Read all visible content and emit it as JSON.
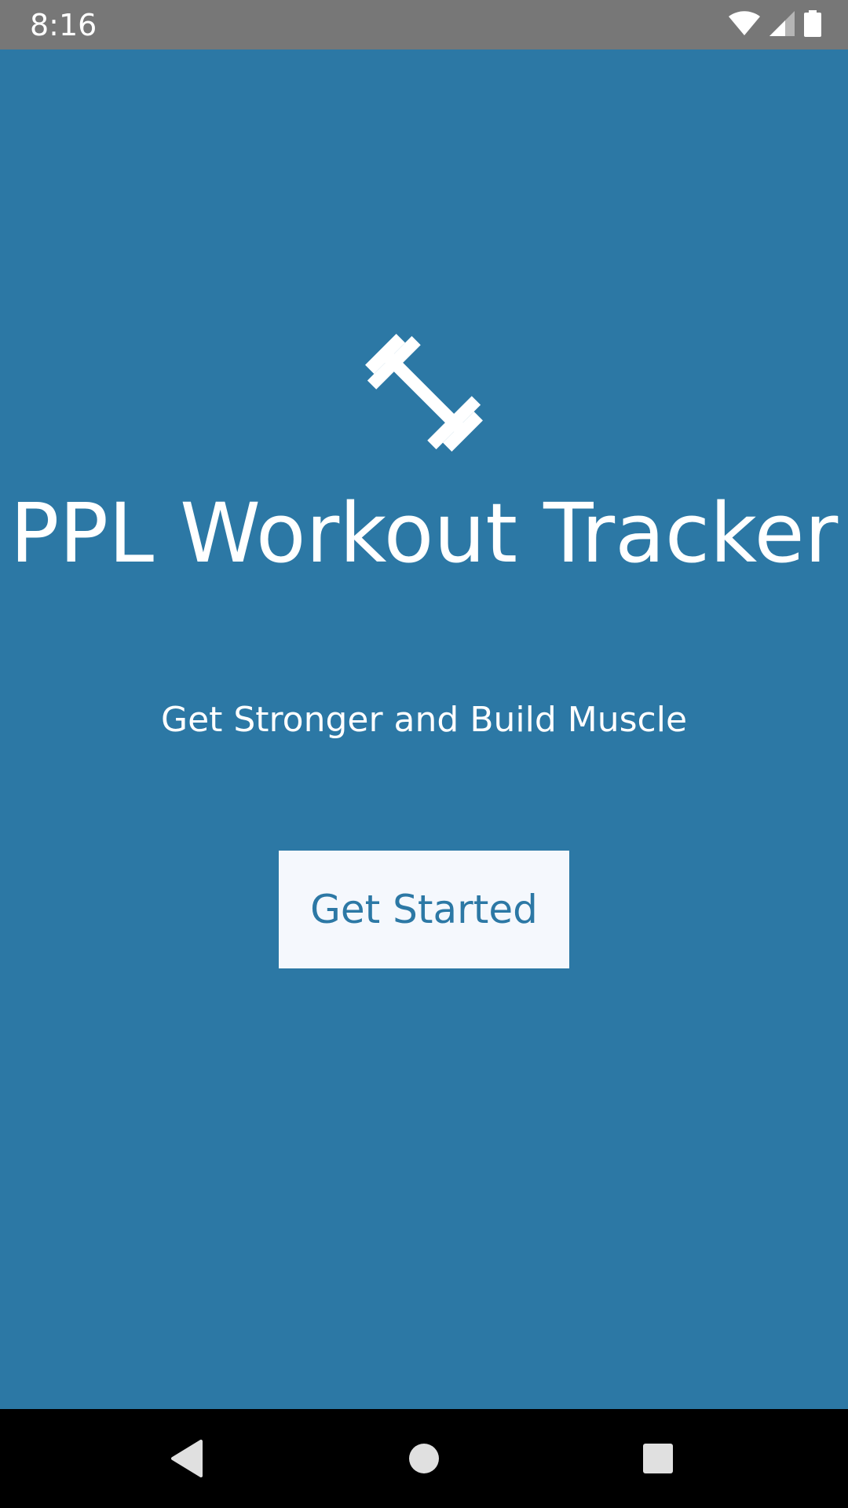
{
  "status_bar": {
    "time": "8:16",
    "icons": [
      "wifi-icon",
      "cellular-signal-icon",
      "battery-icon"
    ]
  },
  "app": {
    "logo_icon": "dumbbell-icon",
    "title": "PPL Workout Tracker",
    "subtitle": "Get Stronger and Build Muscle",
    "cta_label": "Get Started"
  },
  "nav_bar": {
    "buttons": [
      "back-icon",
      "home-icon",
      "recents-icon"
    ]
  },
  "colors": {
    "background": "#2c78a5",
    "status_bar": "#777777",
    "button_bg": "#f5f8fd",
    "button_text": "#2c78a5",
    "nav_bar": "#000000"
  }
}
